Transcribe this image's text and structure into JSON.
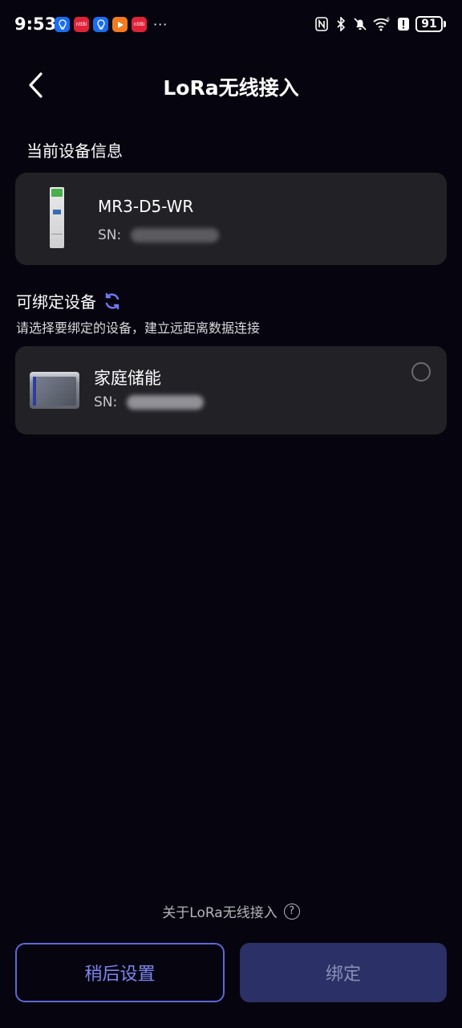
{
  "status_bar": {
    "time": "9:53",
    "app_icons": [
      {
        "name": "bulb-app-icon",
        "color": "#1a6cf0",
        "label": ""
      },
      {
        "name": "news-app-icon",
        "color": "#e02238",
        "label": "ntIBi"
      },
      {
        "name": "bulb-app-icon-2",
        "color": "#1a6cf0",
        "label": ""
      },
      {
        "name": "play-app-icon",
        "color": "#f37a1f",
        "label": ""
      },
      {
        "name": "news-app-icon-2",
        "color": "#e02238",
        "label": "ntIBi"
      }
    ],
    "more": "···",
    "battery_level": "91"
  },
  "header": {
    "title": "LoRa无线接入"
  },
  "current_section": {
    "title": "当前设备信息",
    "device": {
      "name": "MR3-D5-WR",
      "sn_label": "SN:"
    }
  },
  "bind_section": {
    "title": "可绑定设备",
    "subtitle": "请选择要绑定的设备，建立远距离数据连接",
    "devices": [
      {
        "name": "家庭储能",
        "sn_label": "SN:",
        "selected": false
      }
    ]
  },
  "footer": {
    "about_label": "关于LoRa无线接入",
    "later_button": "稍后设置",
    "bind_button": "绑定"
  },
  "colors": {
    "background": "#06050f",
    "card": "#212126",
    "accent": "#5e67d6",
    "refresh": "#6f7cf5",
    "disabled_button": "#2b3166"
  }
}
